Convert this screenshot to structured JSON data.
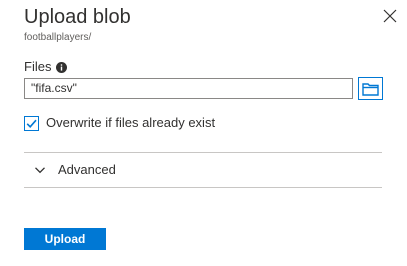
{
  "header": {
    "title": "Upload blob",
    "subtitle": "footballplayers/",
    "close_icon": "close-icon"
  },
  "files": {
    "label": "Files",
    "info_icon": "info-icon",
    "value": "\"fifa.csv\"",
    "browse_icon": "folder-icon"
  },
  "overwrite": {
    "label": "Overwrite if files already exist",
    "checked": true
  },
  "advanced": {
    "label": "Advanced",
    "expanded": false,
    "chevron_icon": "chevron-down-icon"
  },
  "actions": {
    "upload_label": "Upload"
  },
  "colors": {
    "accent": "#0078d4",
    "text": "#323130",
    "secondary_text": "#605e5c",
    "divider": "#c8c6c4",
    "input_border": "#8a8886"
  }
}
